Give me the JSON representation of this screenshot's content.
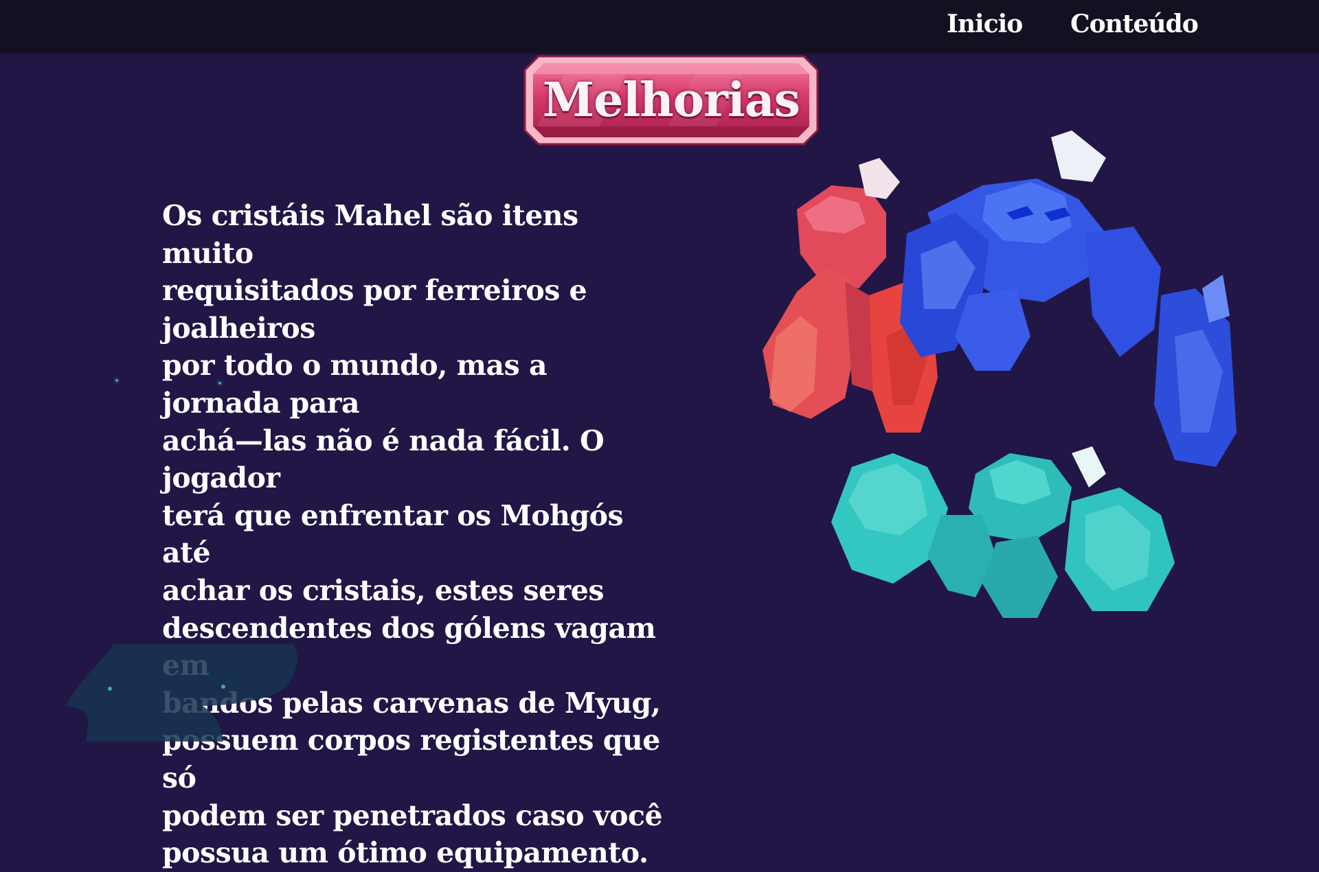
{
  "nav": {
    "items": [
      {
        "label": "Inicio"
      },
      {
        "label": "Conteúdo"
      }
    ]
  },
  "section": {
    "title": "Melhorias",
    "body": "Os cristáis Mahel são itens muito\nrequisitados por ferreiros e joalheiros\npor todo o mundo, mas a jornada para\nachá—las não é nada fácil. O jogador\nterá que enfrentar os Mohgós até\nachar os cristais, estes seres\ndescendentes dos gólens vagam em\nbandos pelas carvenas de Myug,\npossuem corpos registentes que só\npodem ser penetrados caso você\npossua um ótimo equipamento."
  },
  "colors": {
    "background": "#211646",
    "navbar": "#141022",
    "banner": "#d23c66",
    "golem_red": "#e8434f",
    "golem_blue": "#2f4fe0",
    "golem_teal": "#36c9c4"
  },
  "images": {
    "banner": "ruby-plaque-icon",
    "golems": "crystal-golems-illustration",
    "silhouette": "creature-silhouette"
  }
}
